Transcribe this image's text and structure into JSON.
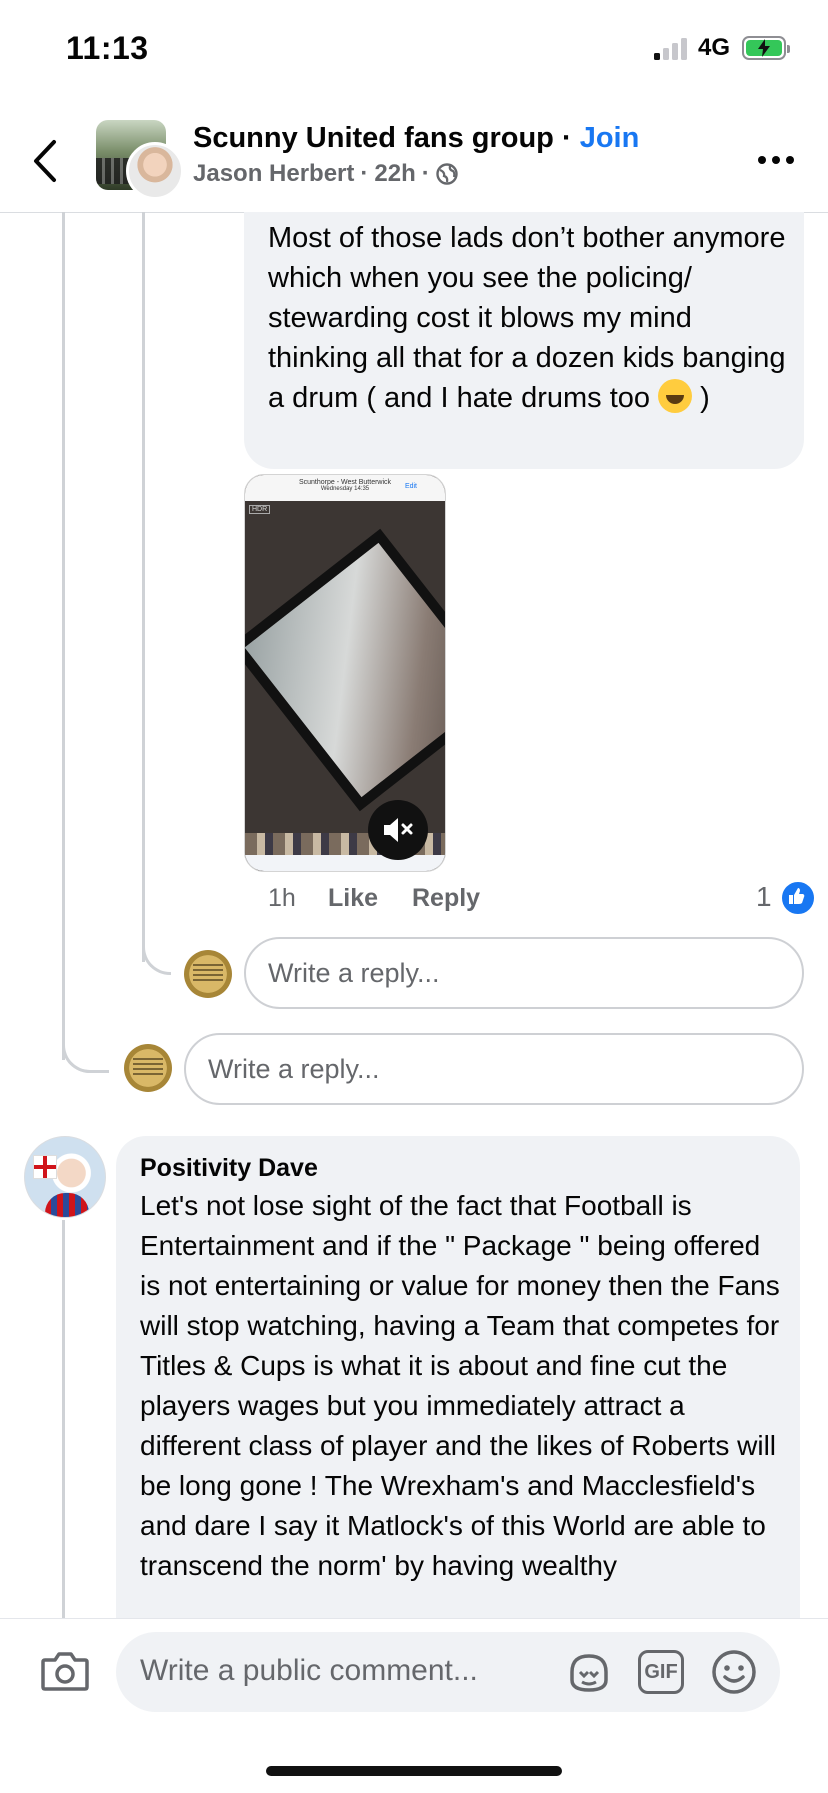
{
  "status_bar": {
    "time": "11:13",
    "network": "4G"
  },
  "header": {
    "group_name": "Scunny United fans group",
    "separator": " · ",
    "join_label": "Join",
    "author": "Jason Herbert",
    "time_ago": "22h",
    "dot": "·"
  },
  "reply_comment": {
    "text_before_emoji": "Most of those lads don’t bother anymore which when you see the policing/ stewarding cost it blows my mind thinking all that for a dozen kids banging a drum ( and I hate drums too ",
    "text_after_emoji": " )",
    "emoji": "rolling-on-floor-laughing",
    "video": {
      "title": "Scunthorpe - West Butterwick",
      "subtitle": "Wednesday 14:35",
      "edit": "Edit",
      "hdr": "HDR",
      "muted": true
    },
    "time": "1h",
    "like_label": "Like",
    "reply_label": "Reply",
    "reaction_count": "1"
  },
  "reply_inputs": {
    "placeholder": "Write a reply..."
  },
  "comment": {
    "author": "Positivity Dave",
    "text": "Let's not lose sight of the fact  that Football is Entertainment and if the \" Package \" being offered is not entertaining or value for money then the Fans will stop watching, having a Team that competes for Titles & Cups is what it is about and fine cut the players wages but you immediately attract a different class of player and the likes of Roberts will be long gone ! The Wrexham's and Macclesfield's and dare I say it Matlock's of this World are able to transcend the norm' by having wealthy"
  },
  "composer": {
    "placeholder": "Write a public comment...",
    "gif_label": "GIF"
  },
  "colors": {
    "accent": "#1877f2",
    "bubble": "#f0f2f5",
    "secondary_text": "#65676b",
    "battery": "#34c759"
  }
}
